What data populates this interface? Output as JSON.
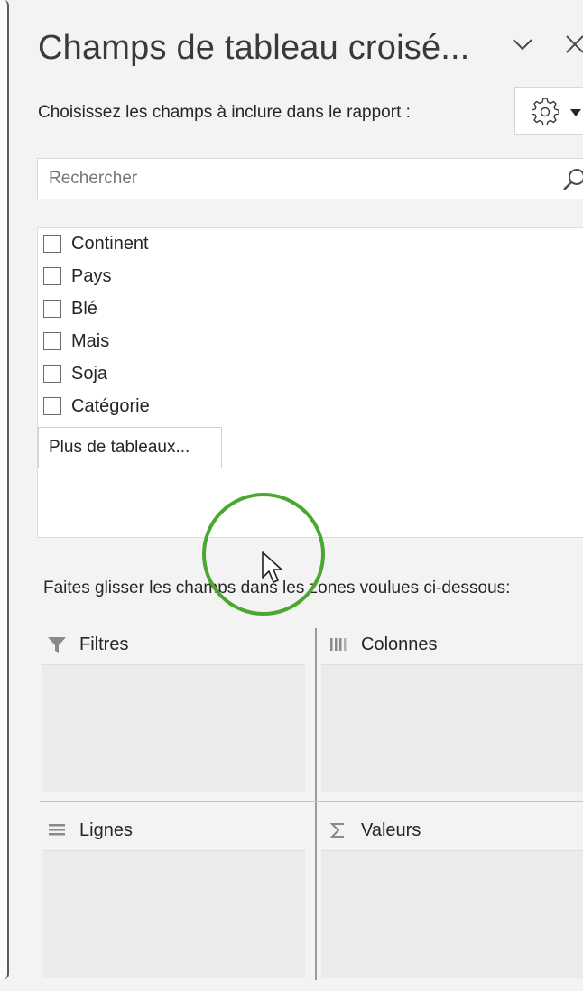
{
  "panel": {
    "title": "Champs de tableau croisé...",
    "subtitle": "Choisissez les champs à inclure dans le rapport :",
    "icons": {
      "collapse": "chevron-down-icon",
      "close": "close-icon",
      "settings": "gear-icon",
      "settings_dropdown": "caret-down-icon"
    }
  },
  "search": {
    "placeholder": "Rechercher",
    "value": "",
    "icon": "search-icon"
  },
  "fields": [
    {
      "label": "Continent",
      "checked": false
    },
    {
      "label": "Pays",
      "checked": false
    },
    {
      "label": "Blé",
      "checked": false
    },
    {
      "label": "Mais",
      "checked": false
    },
    {
      "label": "Soja",
      "checked": false
    },
    {
      "label": "Catégorie",
      "checked": false
    }
  ],
  "more_tables_label": "Plus de tableaux...",
  "drag_hint": "Faites glisser les champs dans les zones voulues ci-dessous:",
  "areas": {
    "filters": {
      "label": "Filtres",
      "icon": "filter-icon"
    },
    "columns": {
      "label": "Colonnes",
      "icon": "columns-icon"
    },
    "rows": {
      "label": "Lignes",
      "icon": "rows-icon"
    },
    "values": {
      "label": "Valeurs",
      "icon": "sigma-icon"
    }
  },
  "colors": {
    "highlight_circle": "#4aa82e",
    "panel_background": "#f3f3f3",
    "area_background": "#ebebeb"
  }
}
